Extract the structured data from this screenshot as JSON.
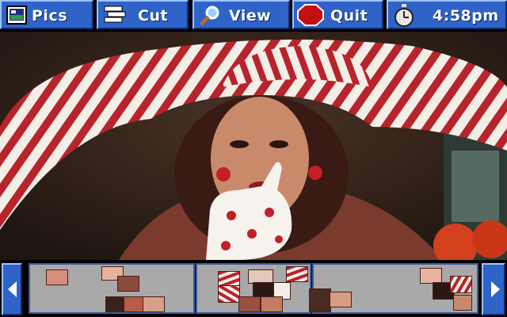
{
  "toolbar": {
    "pics_label": "Pics",
    "cut_label": "Cut",
    "view_label": "View",
    "quit_label": "Quit",
    "clock_time": "4:58pm"
  },
  "icons": {
    "pics": "picture-frame-icon",
    "cut": "cut-pieces-icon",
    "view": "magnifier-icon",
    "quit": "stop-sign-icon",
    "clock": "stopwatch-icon",
    "scroll_left": "left-arrow-icon",
    "scroll_right": "right-arrow-icon"
  },
  "colors": {
    "button_blue": "#2f63c8",
    "tray_gray": "#a9a9a9",
    "quit_red": "#c41010"
  }
}
